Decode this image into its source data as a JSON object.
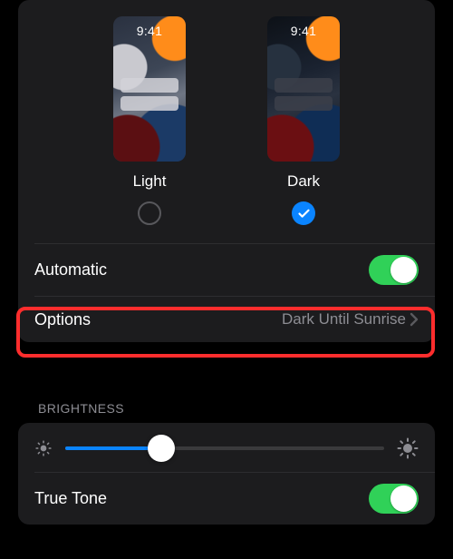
{
  "appearance": {
    "light": {
      "time": "9:41",
      "label": "Light",
      "selected": false
    },
    "dark": {
      "time": "9:41",
      "label": "Dark",
      "selected": true
    }
  },
  "automatic": {
    "label": "Automatic",
    "on": true
  },
  "options": {
    "label": "Options",
    "value": "Dark Until Sunrise"
  },
  "brightness": {
    "header": "BRIGHTNESS",
    "value_percent": 30
  },
  "true_tone": {
    "label": "True Tone",
    "on": true
  },
  "colors": {
    "accent": "#0a84ff",
    "toggle_on": "#30d158",
    "highlight": "#ff2d2d"
  }
}
